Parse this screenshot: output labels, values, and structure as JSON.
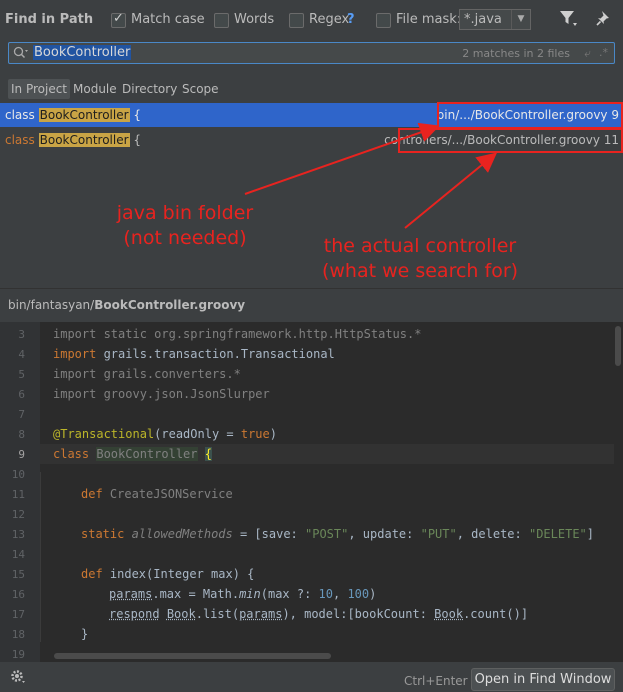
{
  "header": {
    "title": "Find in Path",
    "match_case": "Match case",
    "words": "Words",
    "regex": "Regex",
    "regex_help": "?",
    "file_mask": "File mask:",
    "file_mask_value": "*.java"
  },
  "search": {
    "value": "BookController",
    "matches": "2 matches in 2 files"
  },
  "scopes": [
    "In Project",
    "Module",
    "Directory",
    "Scope"
  ],
  "results": [
    {
      "keyword": "class",
      "match": "BookController",
      "rest": " {",
      "path": "bin/.../BookController.groovy 9"
    },
    {
      "keyword": "class",
      "match": "BookController",
      "rest": " {",
      "path": "controllers/.../BookController.groovy 11"
    }
  ],
  "annotations": {
    "left_line1": "java bin folder",
    "left_line2": "(not needed)",
    "right_line1": "the actual controller",
    "right_line2": "(what we search for)",
    "color": "#e8231f"
  },
  "preview": {
    "path_prefix": "bin/fantasyan/",
    "path_file": "BookController.groovy",
    "line_numbers": [
      "3",
      "4",
      "5",
      "6",
      "7",
      "8",
      "9",
      "10",
      "11",
      "12",
      "13",
      "14",
      "15",
      "16",
      "17",
      "18",
      "19"
    ]
  },
  "footer": {
    "shortcut": "Ctrl+Enter",
    "open_button": "Open in Find Window"
  }
}
